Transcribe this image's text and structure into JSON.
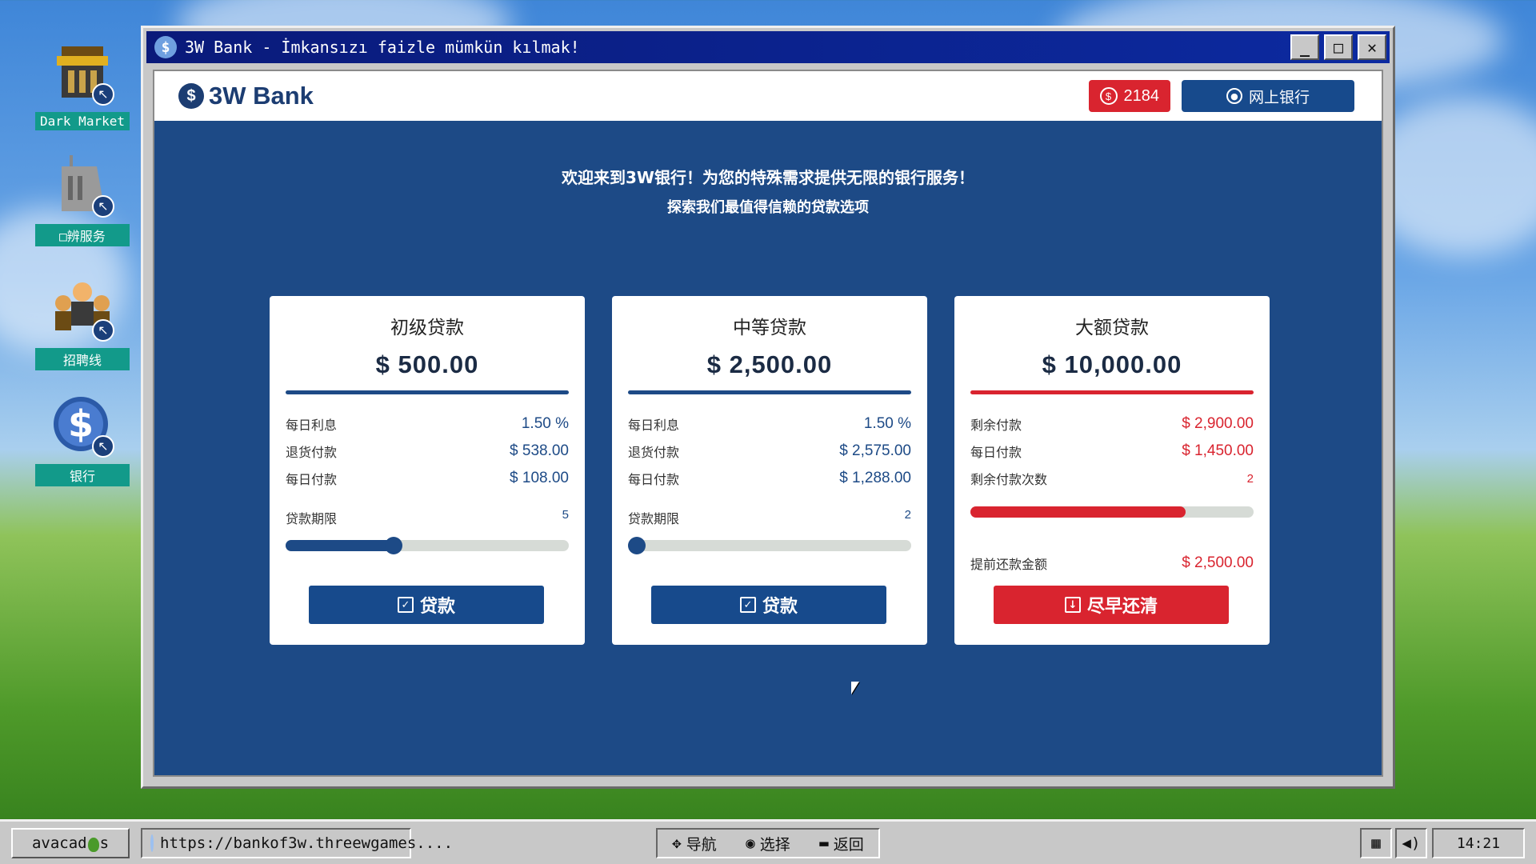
{
  "window": {
    "title": "3W Bank - İmkansızı faizle mümkün kılmak!",
    "minimize": "_",
    "maximize": "□",
    "close": "✕"
  },
  "desktop": {
    "icons": [
      {
        "label": "Dark Market",
        "icon": "market-stall-icon"
      },
      {
        "label": "□辨服务",
        "icon": "building-icon"
      },
      {
        "label": "招聘线",
        "icon": "people-icon"
      },
      {
        "label": "银行",
        "icon": "dollar-coin-icon"
      }
    ]
  },
  "header": {
    "logo": "3W Bank",
    "coins": "2184",
    "online_banking": "网上银行"
  },
  "welcome": {
    "line1": "欢迎来到3W银行！为您的特殊需求提供无限的银行服务！",
    "line2": "探索我们最值得信赖的贷款选项"
  },
  "cards": [
    {
      "title": "初级贷款",
      "amount": "$ 500.00",
      "rows": [
        {
          "label": "每日利息",
          "value": "1.50 %"
        },
        {
          "label": "退货付款",
          "value": "$ 538.00"
        },
        {
          "label": "每日付款",
          "value": "$ 108.00"
        }
      ],
      "term_label": "贷款期限",
      "term_value": "5",
      "slider_fraction": 0.38,
      "button": "贷款"
    },
    {
      "title": "中等贷款",
      "amount": "$ 2,500.00",
      "rows": [
        {
          "label": "每日利息",
          "value": "1.50 %"
        },
        {
          "label": "退货付款",
          "value": "$ 2,575.00"
        },
        {
          "label": "每日付款",
          "value": "$ 1,288.00"
        }
      ],
      "term_label": "贷款期限",
      "term_value": "2",
      "slider_fraction": 0.0,
      "button": "贷款"
    },
    {
      "title": "大额贷款",
      "amount": "$ 10,000.00",
      "rows": [
        {
          "label": "剩余付款",
          "value": "$ 2,900.00"
        },
        {
          "label": "每日付款",
          "value": "$ 1,450.00"
        },
        {
          "label": "剩余付款次数",
          "value": "2"
        }
      ],
      "progress_fraction": 0.76,
      "prepay_label": "提前还款金额",
      "prepay_value": "$ 2,500.00",
      "button": "尽早还清"
    }
  ],
  "taskbar": {
    "start": [
      "avacad",
      "s"
    ],
    "url": "https://bankof3w.threewgames....",
    "nav": "导航",
    "select": "选择",
    "back": "返回",
    "clock": "14:21"
  },
  "colors": {
    "brand_blue": "#1d4a86",
    "accent_red": "#d9242f",
    "title_bar": "#0a1a7a"
  }
}
